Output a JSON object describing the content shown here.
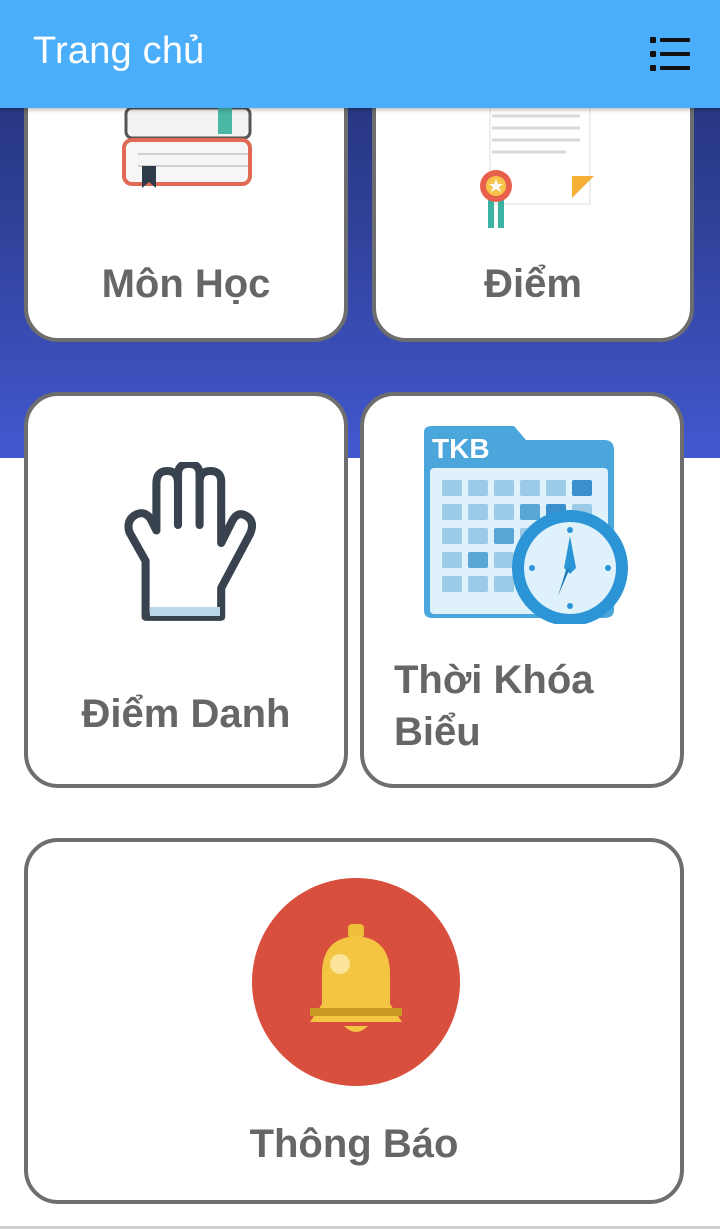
{
  "header": {
    "title": "Trang chủ",
    "menu_icon": "list-menu-icon"
  },
  "colors": {
    "header": "#4aaefb",
    "hero_top": "#1f2f6e",
    "hero_bottom": "#4258cf",
    "card_border": "#6e6e6e",
    "label": "#666666"
  },
  "tiles": {
    "subjects": {
      "label": "Môn Học",
      "icon": "books-icon"
    },
    "grades": {
      "label": "Điểm",
      "icon": "certificate-icon"
    },
    "attendance": {
      "label": "Điểm Danh",
      "icon": "hand-glove-icon"
    },
    "timetable": {
      "label": "Thời Khóa Biểu",
      "icon": "timetable-calendar-icon",
      "icon_text": "TKB"
    },
    "notifications": {
      "label": "Thông Báo",
      "icon": "bell-icon"
    }
  }
}
